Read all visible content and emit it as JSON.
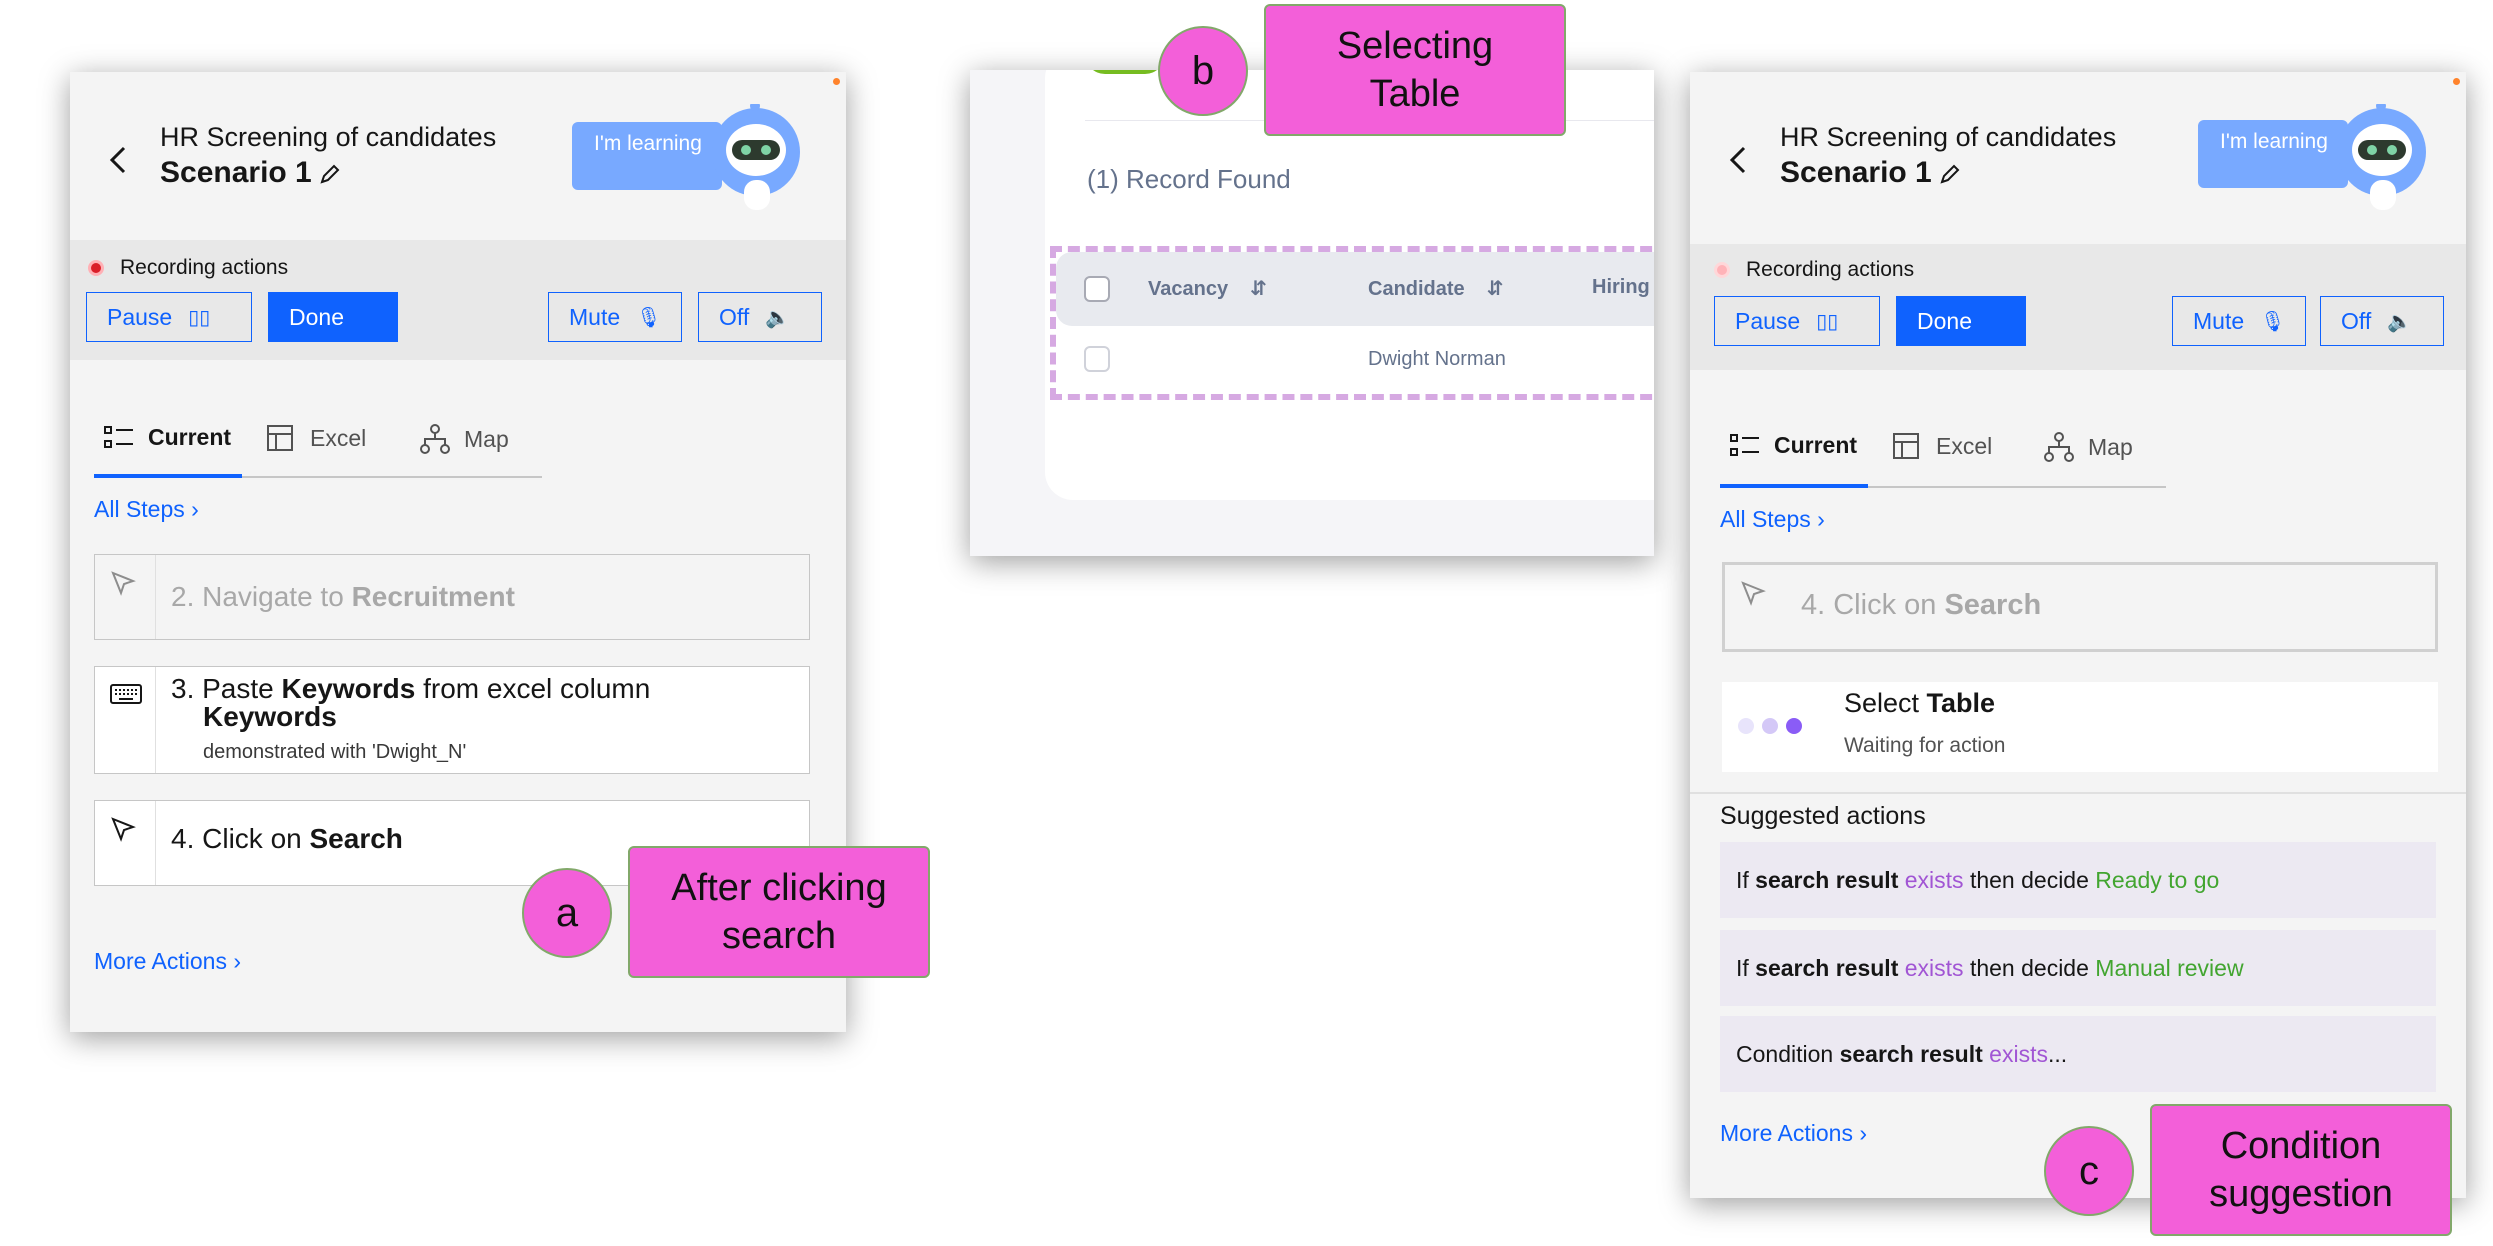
{
  "panel_a": {
    "title": "HR Screening of candidates",
    "subtitle": "Scenario 1",
    "learning": "I'm learning",
    "recording": "Recording actions",
    "pause": "Pause",
    "done": "Done",
    "mute": "Mute",
    "off": "Off",
    "tabs": [
      "Current",
      "Excel",
      "Map"
    ],
    "all_steps": "All Steps",
    "step2": {
      "prefix": "2. Navigate to ",
      "bold": "Recruitment"
    },
    "step3": {
      "prefix": "3. Paste ",
      "bold1": "Keywords",
      "middle": " from excel column",
      "bold2": "Keywords",
      "note": "demonstrated with 'Dwight_N'"
    },
    "step4": {
      "prefix": "4. Click on ",
      "bold": "Search"
    },
    "more_actions": "More Actions"
  },
  "panel_b": {
    "records": "(1) Record Found",
    "columns": [
      "Vacancy",
      "Candidate",
      "Hiring M"
    ],
    "row": {
      "candidate": "Dwight Norman"
    }
  },
  "panel_c": {
    "title": "HR Screening of candidates",
    "subtitle": "Scenario 1",
    "learning": "I'm learning",
    "recording": "Recording actions",
    "pause": "Pause",
    "done": "Done",
    "mute": "Mute",
    "off": "Off",
    "tabs": [
      "Current",
      "Excel",
      "Map"
    ],
    "all_steps": "All Steps",
    "step4": {
      "prefix": "4. Click on ",
      "bold": "Search"
    },
    "select": {
      "prefix": "Select ",
      "bold": "Table",
      "status": "Waiting for action"
    },
    "suggested_header": "Suggested actions",
    "suggestions": [
      {
        "if": "If ",
        "subject": "search result",
        "verb": " exists",
        "then": " then decide ",
        "outcome": "Ready to go"
      },
      {
        "if": "If ",
        "subject": "search result",
        "verb": " exists",
        "then": " then decide ",
        "outcome": "Manual review"
      },
      {
        "if": "Condition ",
        "subject": "search result",
        "verb": " exists",
        "then": "...",
        "outcome": ""
      }
    ],
    "more_actions": "More Actions"
  },
  "callouts": {
    "a": {
      "letter": "a",
      "text": "After clicking search"
    },
    "b": {
      "letter": "b",
      "text": "Selecting Table"
    },
    "c": {
      "letter": "c",
      "text": "Condition suggestion"
    }
  }
}
